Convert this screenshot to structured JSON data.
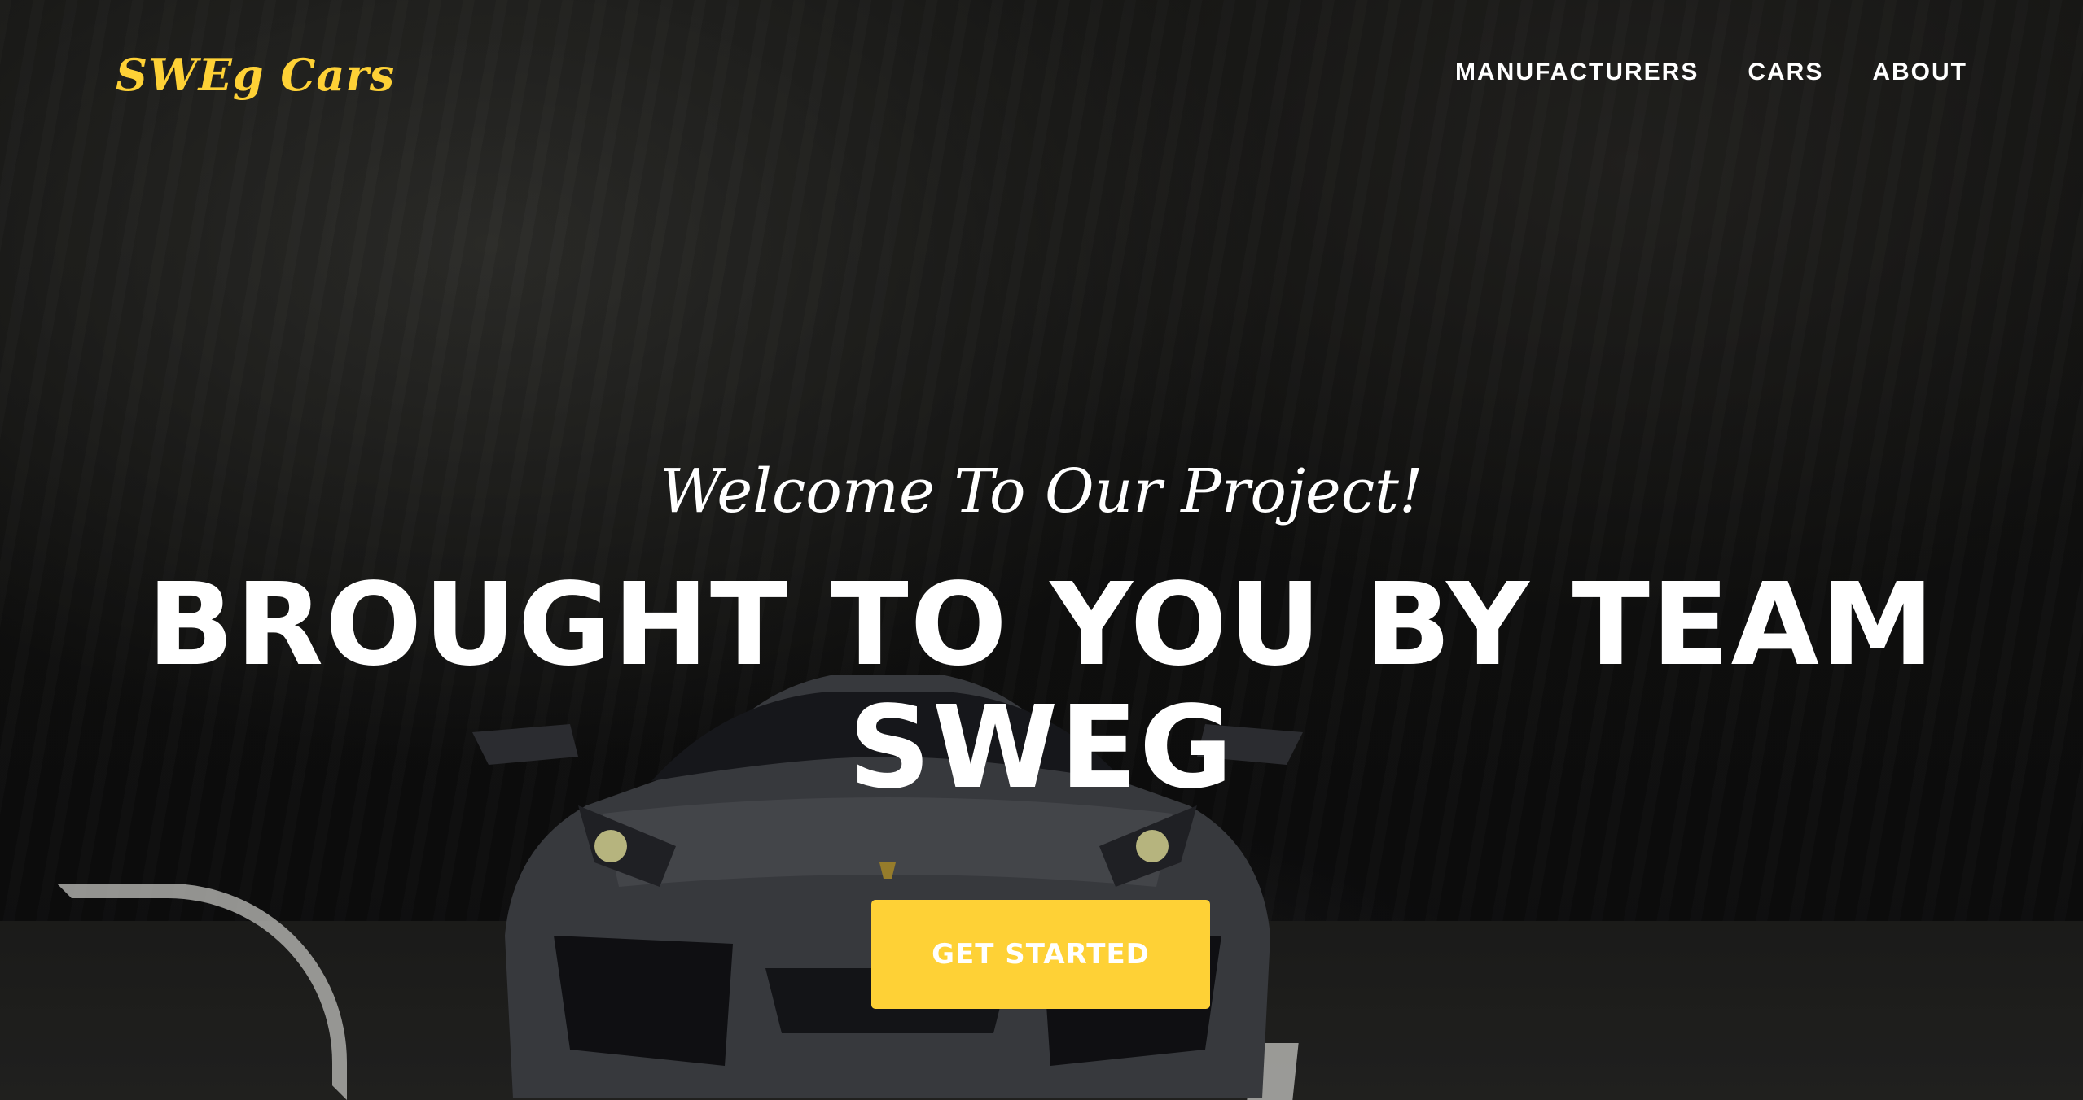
{
  "navbar": {
    "brand": "SWEg Cars",
    "links": [
      {
        "label": "MANUFACTURERS"
      },
      {
        "label": "CARS"
      },
      {
        "label": "ABOUT"
      }
    ]
  },
  "hero": {
    "lead_in": "Welcome To Our Project!",
    "heading": "BROUGHT TO YOU BY TEAM SWEG",
    "cta_label": "GET STARTED",
    "background_description_icon": "sports-car-on-mountain-road-photo"
  },
  "colors": {
    "accent": "#fed136",
    "text": "#ffffff"
  }
}
